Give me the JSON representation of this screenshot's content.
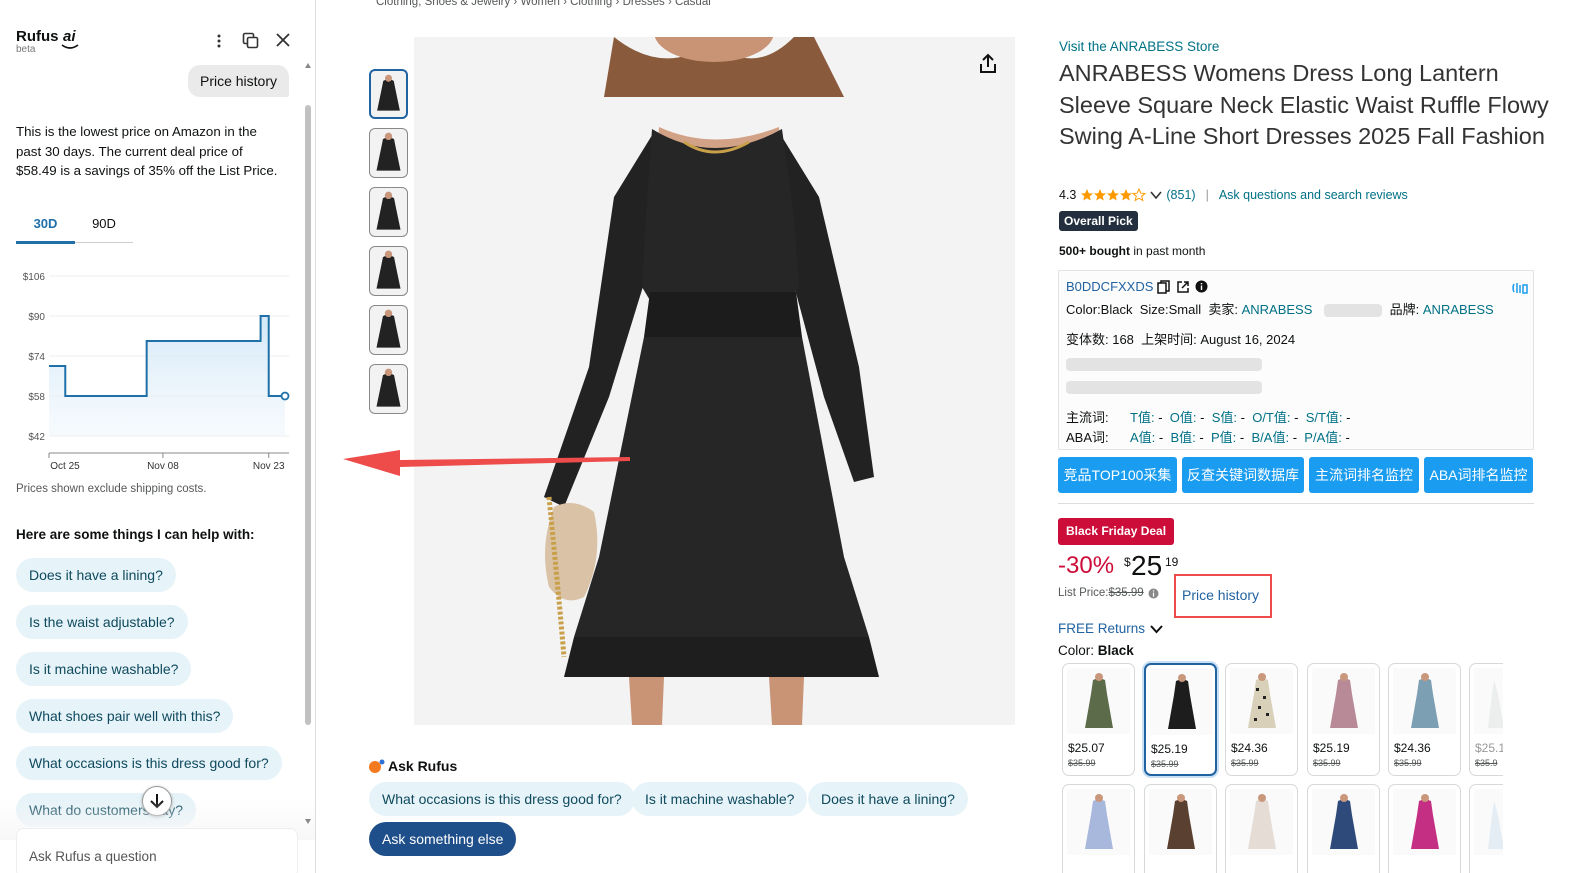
{
  "rufus": {
    "title": "Rufus",
    "ai": "ai",
    "beta": "beta",
    "user_msg": "Price history",
    "answer": "This is the lowest price on Amazon in the past 30 days. The current deal price of $58.49 is a savings of 35% off the List Price.",
    "tabs": [
      "30D",
      "90D"
    ],
    "shipping_note": "Prices shown exclude shipping costs.",
    "help_title": "Here are some things I can help with:",
    "suggestions": [
      "Does it have a lining?",
      "Is the waist adjustable?",
      "Is it machine washable?",
      "What shoes pair well with this?",
      "What occasions is this dress good for?",
      "What do customers say?"
    ],
    "input_placeholder": "Ask Rufus a question"
  },
  "chart_data": {
    "type": "line",
    "yticks": [
      "$106",
      "$90",
      "$74",
      "$58",
      "$42"
    ],
    "xticks": [
      "Oct 25",
      "Nov 08",
      "Nov 23"
    ],
    "ylim": [
      42,
      106
    ],
    "x": [
      0,
      1,
      2,
      3,
      4,
      5,
      6,
      7,
      8,
      9,
      10,
      11,
      12,
      13,
      14,
      15,
      16,
      17,
      18,
      19,
      20,
      21,
      22,
      23,
      24,
      25,
      26,
      27,
      28,
      29
    ],
    "values": [
      70,
      70,
      58,
      58,
      58,
      58,
      58,
      58,
      58,
      58,
      58,
      58,
      80,
      80,
      80,
      80,
      80,
      80,
      80,
      80,
      80,
      80,
      80,
      80,
      80,
      80,
      90,
      58,
      58,
      58
    ],
    "color": "#1f6fa8"
  },
  "breadcrumb": [
    "Clothing, Shoes & Jewelry",
    "Women",
    "Clothing",
    "Dresses",
    "Casual"
  ],
  "product": {
    "store_link": "Visit the ANRABESS Store",
    "title": "ANRABESS Womens Dress Long Lantern Sleeve Square Neck Elastic Waist Ruffle Flowy Swing A-Line Short Dresses 2025 Fall Fashion",
    "rating": "4.3",
    "reviews": "(851)",
    "ask_link": "Ask questions and search reviews",
    "badge": "Overall Pick",
    "bought_bold": "500+ bought",
    "bought_rest": " in past month"
  },
  "plugin": {
    "asin": "B0DDCFXXDS",
    "color_label": "Color:Black",
    "size_label": "Size:Small",
    "seller_label": "卖家: ",
    "seller": "ANRABESS",
    "brand_label": "品牌: ",
    "brand": "ANRABESS",
    "variants": "变体数: 168",
    "listed": "上架时间: August 16, 2024",
    "row1_label": "主流词:",
    "row1": [
      [
        "T值:",
        "-"
      ],
      [
        "O值:",
        "-"
      ],
      [
        "S值:",
        "-"
      ],
      [
        "O/T值:",
        "-"
      ],
      [
        "S/T值:",
        "-"
      ]
    ],
    "row2_label": "ABA词:",
    "row2": [
      [
        "A值:",
        "-"
      ],
      [
        "B值:",
        "-"
      ],
      [
        "P值:",
        "-"
      ],
      [
        "B/A值:",
        "-"
      ],
      [
        "P/A值:",
        "-"
      ]
    ],
    "buttons": [
      "竞品TOP100采集",
      "反查关键词数据库",
      "主流词排名监控",
      "ABA词排名监控"
    ]
  },
  "price": {
    "deal_badge": "Black Friday Deal",
    "discount": "-30%",
    "currency": "$",
    "whole": "25",
    "fraction": "19",
    "list_label": "List Price: ",
    "list_price": "$35.99",
    "history_link": "Price history",
    "free_returns": "FREE Returns",
    "color_label": "Color: ",
    "color_value": "Black",
    "swatches": [
      {
        "price": "$25.07",
        "list": "$35.99"
      },
      {
        "price": "$25.19",
        "list": "$35.99"
      },
      {
        "price": "$24.36",
        "list": "$35.99"
      },
      {
        "price": "$25.19",
        "list": "$35.99"
      },
      {
        "price": "$24.36",
        "list": "$35.99"
      },
      {
        "price": "$25.1",
        "list": "$35.9"
      }
    ]
  },
  "ask_rufus": {
    "title": "Ask Rufus",
    "chips": [
      "What occasions is this dress good for?",
      "Is it machine washable?",
      "Does it have a lining?"
    ],
    "ask_else": "Ask something else"
  },
  "colors": {
    "accent": "#1a9cf0",
    "deal": "#cc0c39",
    "link": "#2162a1",
    "pill_bg": "#e6f3f8",
    "arrow": "#ee4b4b"
  }
}
